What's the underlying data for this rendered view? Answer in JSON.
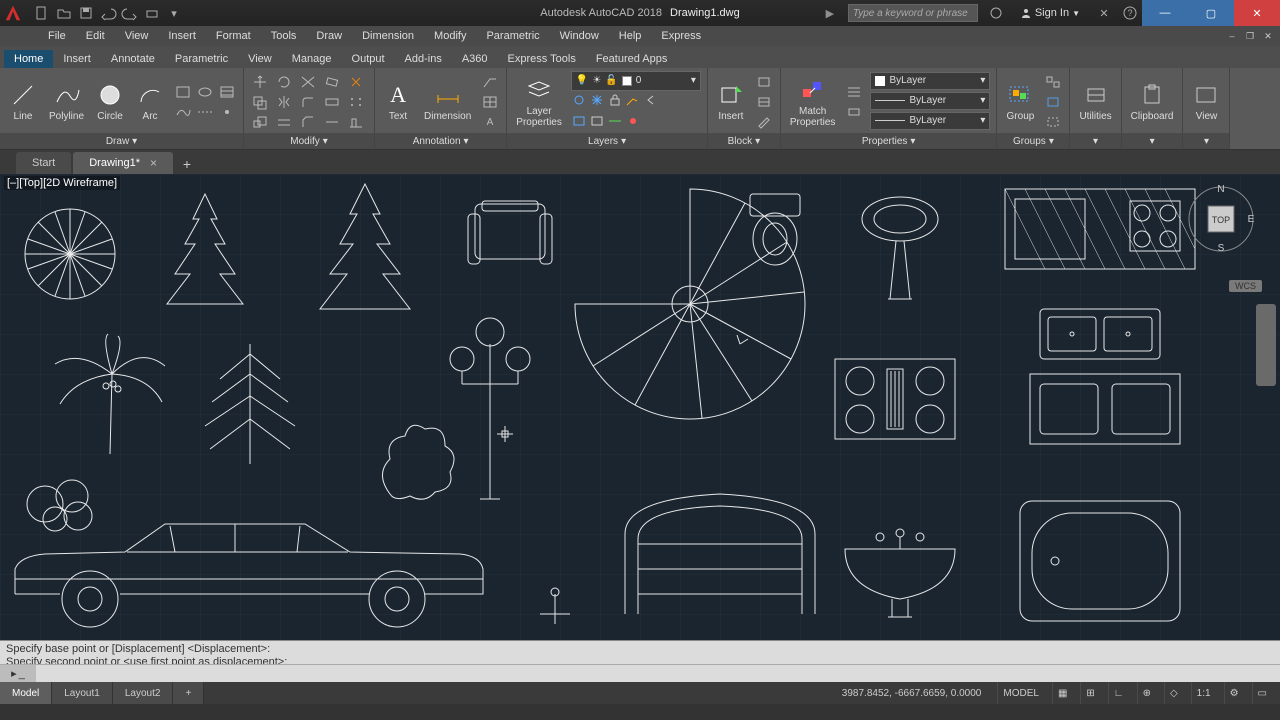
{
  "title": {
    "app": "Autodesk AutoCAD 2018",
    "doc": "Drawing1.dwg"
  },
  "search": {
    "placeholder": "Type a keyword or phrase"
  },
  "signin": {
    "label": "Sign In"
  },
  "menus": [
    "File",
    "Edit",
    "View",
    "Insert",
    "Format",
    "Tools",
    "Draw",
    "Dimension",
    "Modify",
    "Parametric",
    "Window",
    "Help",
    "Express"
  ],
  "ribbon_tabs": [
    "Home",
    "Insert",
    "Annotate",
    "Parametric",
    "View",
    "Manage",
    "Output",
    "Add-ins",
    "A360",
    "Express Tools",
    "Featured Apps"
  ],
  "panels": {
    "draw": {
      "title": "Draw",
      "line": "Line",
      "polyline": "Polyline",
      "circle": "Circle",
      "arc": "Arc"
    },
    "modify": {
      "title": "Modify"
    },
    "annotation": {
      "title": "Annotation",
      "text": "Text",
      "dimension": "Dimension"
    },
    "layers": {
      "title": "Layers",
      "btn": "Layer\nProperties",
      "current": "0"
    },
    "block": {
      "title": "Block",
      "insert": "Insert"
    },
    "properties": {
      "title": "Properties",
      "match": "Match\nProperties",
      "color": "ByLayer",
      "lw": "ByLayer",
      "lt": "ByLayer"
    },
    "groups": {
      "title": "Groups",
      "group": "Group"
    },
    "utilities": {
      "title": "Utilities"
    },
    "clipboard": {
      "title": "Clipboard"
    },
    "view": {
      "title": "View"
    }
  },
  "file_tabs": {
    "start": "Start",
    "drawing": "Drawing1*"
  },
  "viewport": {
    "label": "[–][Top][2D Wireframe]"
  },
  "viewcube": {
    "top": "TOP",
    "n": "N",
    "e": "E",
    "s": "S",
    "wcs": "WCS"
  },
  "cmd": {
    "line1": "Specify base point or [Displacement] <Displacement>:",
    "line2": "Specify second point or <use first point as displacement>:"
  },
  "status": {
    "model": "Model",
    "layout1": "Layout1",
    "layout2": "Layout2",
    "coords": "3987.8452, -6667.6659, 0.0000",
    "model_btn": "MODEL",
    "scale": "1:1"
  }
}
